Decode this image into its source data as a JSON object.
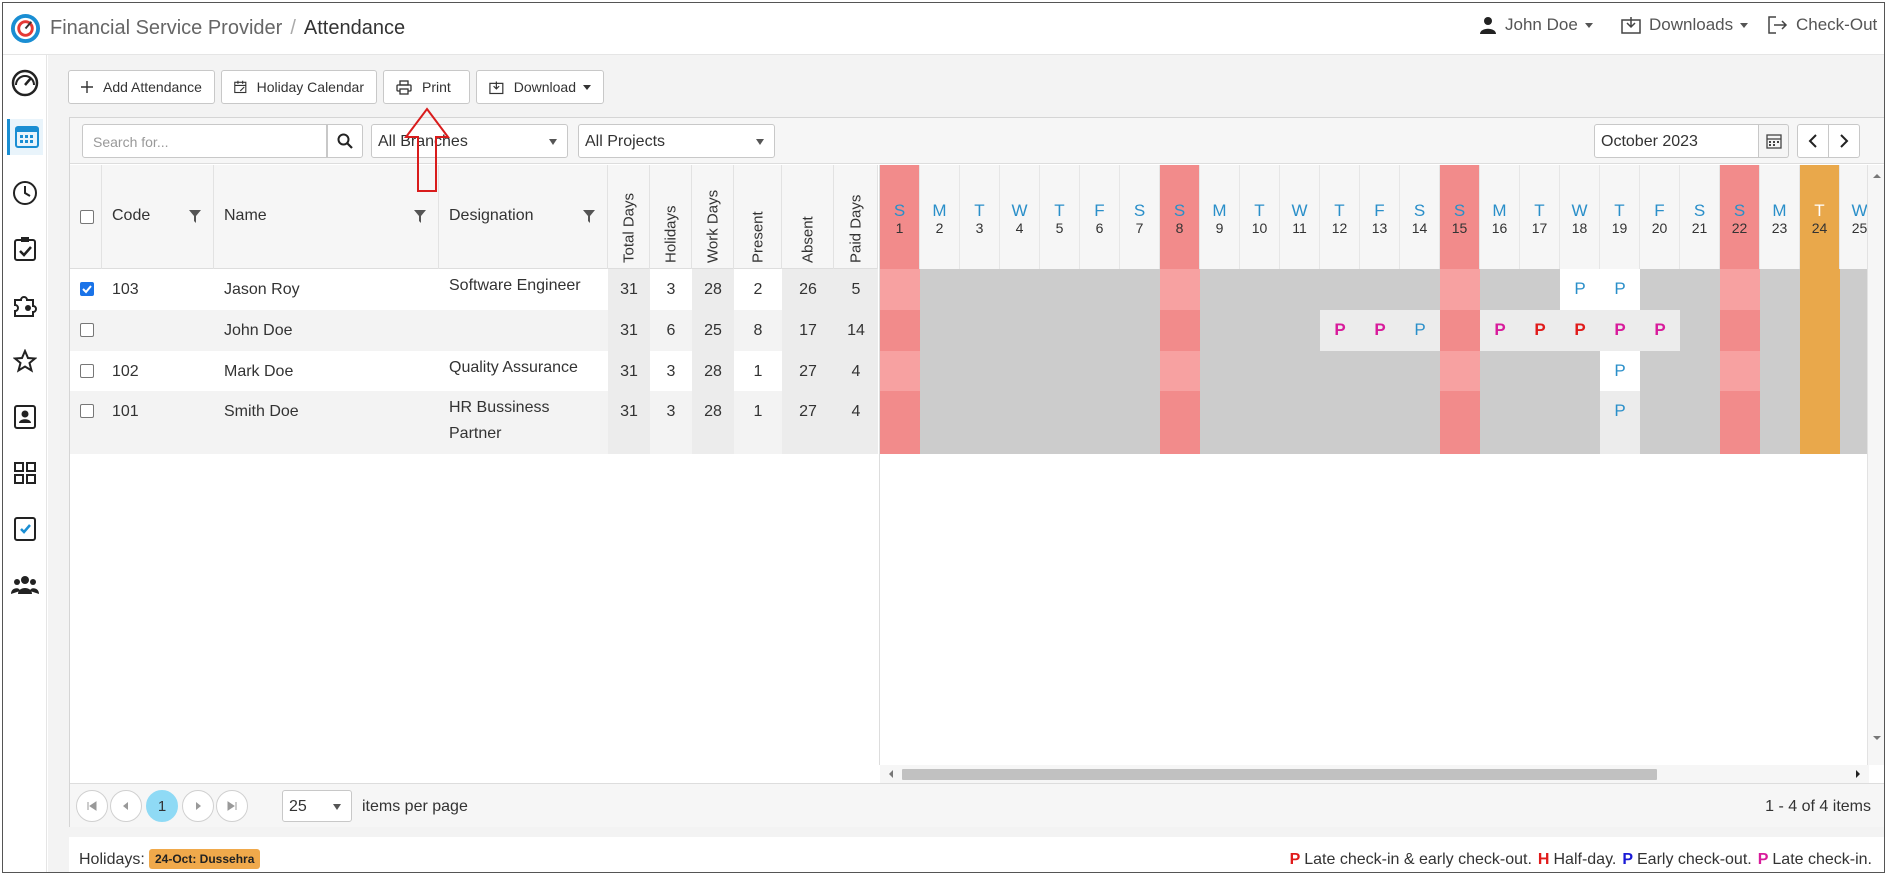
{
  "header": {
    "app_name": "Financial Service Provider",
    "separator": "/",
    "page": "Attendance",
    "user": "John Doe",
    "downloads": "Downloads",
    "checkout": "Check-Out"
  },
  "sidebar": {
    "icons": [
      "dashboard-gauge-icon",
      "calendar-grid-icon",
      "clock-icon",
      "clipboard-check-icon",
      "puzzle-gear-icon",
      "star-icon",
      "id-badge-icon",
      "apps-grid-icon",
      "checklist-icon",
      "team-icon"
    ]
  },
  "toolbar": {
    "add": "Add Attendance",
    "holiday": "Holiday Calendar",
    "print": "Print",
    "download": "Download"
  },
  "filters": {
    "search_placeholder": "Search for...",
    "branches": "All Branches",
    "projects": "All Projects",
    "month": "October 2023"
  },
  "columns": {
    "code": "Code",
    "name": "Name",
    "designation": "Designation",
    "total_days": "Total Days",
    "holidays": "Holidays",
    "work_days": "Work Days",
    "present": "Present",
    "absent": "Absent",
    "paid_days": "Paid Days"
  },
  "rows": [
    {
      "checked": true,
      "code": "103",
      "name": "Jason Roy",
      "designation": "Software Engineer",
      "total": "31",
      "holidays": "3",
      "work": "28",
      "present": "2",
      "absent": "26",
      "paid": "5"
    },
    {
      "checked": false,
      "code": "",
      "name": "John Doe",
      "designation": "",
      "total": "31",
      "holidays": "6",
      "work": "25",
      "present": "8",
      "absent": "17",
      "paid": "14"
    },
    {
      "checked": false,
      "code": "102",
      "name": "Mark Doe",
      "designation": "Quality Assurance",
      "total": "31",
      "holidays": "3",
      "work": "28",
      "present": "1",
      "absent": "27",
      "paid": "4"
    },
    {
      "checked": false,
      "code": "101",
      "name": "Smith Doe",
      "designation": "HR Bussiness Partner",
      "total": "31",
      "holidays": "3",
      "work": "28",
      "present": "1",
      "absent": "27",
      "paid": "4"
    }
  ],
  "days": [
    {
      "l": "S",
      "n": "1",
      "t": "we"
    },
    {
      "l": "M",
      "n": "2",
      "t": ""
    },
    {
      "l": "T",
      "n": "3",
      "t": ""
    },
    {
      "l": "W",
      "n": "4",
      "t": ""
    },
    {
      "l": "T",
      "n": "5",
      "t": ""
    },
    {
      "l": "F",
      "n": "6",
      "t": ""
    },
    {
      "l": "S",
      "n": "7",
      "t": ""
    },
    {
      "l": "S",
      "n": "8",
      "t": "we"
    },
    {
      "l": "M",
      "n": "9",
      "t": ""
    },
    {
      "l": "T",
      "n": "10",
      "t": ""
    },
    {
      "l": "W",
      "n": "11",
      "t": ""
    },
    {
      "l": "T",
      "n": "12",
      "t": ""
    },
    {
      "l": "F",
      "n": "13",
      "t": ""
    },
    {
      "l": "S",
      "n": "14",
      "t": ""
    },
    {
      "l": "S",
      "n": "15",
      "t": "we"
    },
    {
      "l": "M",
      "n": "16",
      "t": ""
    },
    {
      "l": "T",
      "n": "17",
      "t": ""
    },
    {
      "l": "W",
      "n": "18",
      "t": ""
    },
    {
      "l": "T",
      "n": "19",
      "t": ""
    },
    {
      "l": "F",
      "n": "20",
      "t": ""
    },
    {
      "l": "S",
      "n": "21",
      "t": ""
    },
    {
      "l": "S",
      "n": "22",
      "t": "we"
    },
    {
      "l": "M",
      "n": "23",
      "t": ""
    },
    {
      "l": "T",
      "n": "24",
      "t": "hol"
    },
    {
      "l": "W",
      "n": "25",
      "t": ""
    }
  ],
  "marks": [
    {
      "row": 0,
      "day": 18,
      "v": "P",
      "c": "#2a8fc9"
    },
    {
      "row": 0,
      "day": 19,
      "v": "P",
      "c": "#2a8fc9"
    },
    {
      "row": 1,
      "day": 12,
      "v": "P",
      "c": "#d81b9b"
    },
    {
      "row": 1,
      "day": 13,
      "v": "P",
      "c": "#d81b9b"
    },
    {
      "row": 1,
      "day": 14,
      "v": "P",
      "c": "#2a8fc9"
    },
    {
      "row": 1,
      "day": 16,
      "v": "P",
      "c": "#d81b9b"
    },
    {
      "row": 1,
      "day": 17,
      "v": "P",
      "c": "#e01b1b"
    },
    {
      "row": 1,
      "day": 18,
      "v": "P",
      "c": "#e01b1b"
    },
    {
      "row": 1,
      "day": 19,
      "v": "P",
      "c": "#d81b9b"
    },
    {
      "row": 1,
      "day": 20,
      "v": "P",
      "c": "#d81b9b"
    },
    {
      "row": 2,
      "day": 19,
      "v": "P",
      "c": "#2a8fc9"
    },
    {
      "row": 3,
      "day": 19,
      "v": "P",
      "c": "#2a8fc9"
    }
  ],
  "pager": {
    "page": "1",
    "per_page": "25",
    "per_page_label": "items per page",
    "count": "1 - 4 of 4 items"
  },
  "footer": {
    "holidays_label": "Holidays:",
    "holiday": "24-Oct: Dussehra",
    "legend": [
      {
        "k": "P",
        "c": "#e01b1b",
        "text": "Late check-in & early check-out."
      },
      {
        "k": "H",
        "c": "#e01b1b",
        "text": "Half-day."
      },
      {
        "k": "P",
        "c": "#1a1ad6",
        "text": "Early check-out."
      },
      {
        "k": "P",
        "c": "#d81b9b",
        "text": "Late check-in."
      }
    ]
  },
  "colors": {
    "accent": "#1a8ed3",
    "weekend": "#f28b8b",
    "holiday": "#e9a84b",
    "absent": "#cccccc"
  }
}
